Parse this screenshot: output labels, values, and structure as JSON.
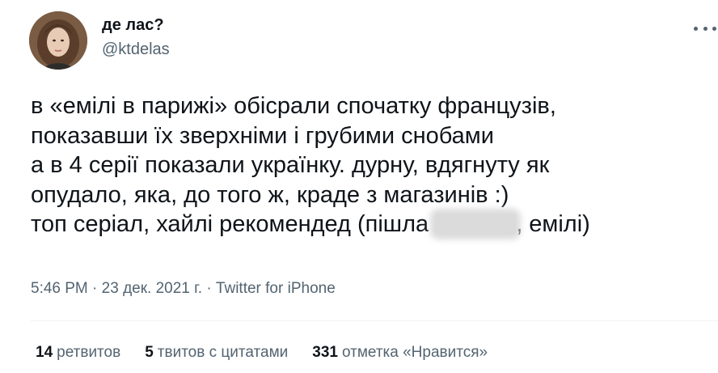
{
  "author": {
    "display_name": "де лас?",
    "handle": "@ktdelas"
  },
  "tweet": {
    "line1": "в «емілі в парижі» обісрали спочатку французів,",
    "line2": "показавши їх зверхніми і грубими снобами",
    "line3": "а в 4 серії показали українку. дурну, вдягнуту як",
    "line4": "опудало, яка, до того ж, краде з магазинів :)",
    "line5_before": "топ серіал, хайлі рекомендед (пішла",
    "line5_after": ", емілі)"
  },
  "meta": {
    "time": "5:46 PM",
    "date": "23 дек. 2021 г.",
    "source": "Twitter for iPhone"
  },
  "stats": {
    "retweets_count": "14",
    "retweets_label": "ретвитов",
    "quotes_count": "5",
    "quotes_label": "твитов с цитатами",
    "likes_count": "331",
    "likes_label": "отметка «Нравится»"
  },
  "icons": {
    "more": "more-dots-icon",
    "avatar": "user-avatar"
  }
}
